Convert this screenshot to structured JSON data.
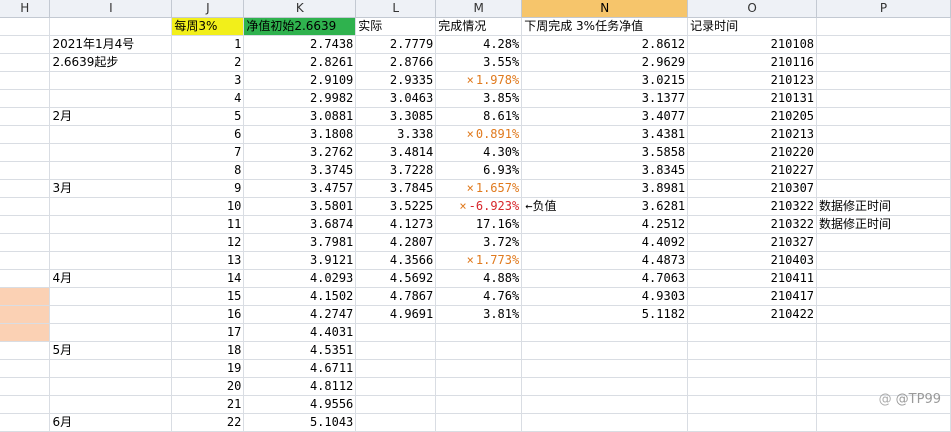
{
  "columns": [
    "H",
    "I",
    "J",
    "K",
    "L",
    "M",
    "N",
    "O",
    "P"
  ],
  "selected_column": "N",
  "header_row": {
    "J": "每周3%",
    "K": "净值初始2.6639",
    "L": "实际",
    "M": "完成情况",
    "N": "下周完成 3%任务净值",
    "O": "记录时间"
  },
  "rows": [
    {
      "I": "2021年1月4号",
      "J": "1",
      "K": "2.7438",
      "L": "2.7779",
      "M": "4.28%",
      "N": "2.8612",
      "O": "210108"
    },
    {
      "I": "2.6639起步",
      "J": "2",
      "K": "2.8261",
      "L": "2.8766",
      "M": "3.55%",
      "N": "2.9629",
      "O": "210116"
    },
    {
      "J": "3",
      "K": "2.9109",
      "L": "2.9335",
      "M": "1.978%",
      "mark": "×",
      "N": "3.0215",
      "O": "210123"
    },
    {
      "J": "4",
      "K": "2.9982",
      "L": "3.0463",
      "M": "3.85%",
      "N": "3.1377",
      "O": "210131"
    },
    {
      "I": "2月",
      "J": "5",
      "K": "3.0881",
      "L": "3.3085",
      "M": "8.61%",
      "N": "3.4077",
      "O": "210205"
    },
    {
      "J": "6",
      "K": "3.1808",
      "L": "3.338",
      "M": "0.891%",
      "mark": "×",
      "N": "3.4381",
      "O": "210213"
    },
    {
      "J": "7",
      "K": "3.2762",
      "L": "3.4814",
      "M": "4.30%",
      "N": "3.5858",
      "O": "210220"
    },
    {
      "J": "8",
      "K": "3.3745",
      "L": "3.7228",
      "M": "6.93%",
      "N": "3.8345",
      "O": "210227"
    },
    {
      "I": "3月",
      "J": "9",
      "K": "3.4757",
      "L": "3.7845",
      "M": "1.657%",
      "mark": "×",
      "N": "3.8981",
      "O": "210307"
    },
    {
      "J": "10",
      "K": "3.5801",
      "L": "3.5225",
      "M": "-6.923%",
      "mark": "×",
      "neg": true,
      "Nnote": "←负值",
      "N": "3.6281",
      "O": "210322",
      "P": "数据修正时间"
    },
    {
      "J": "11",
      "K": "3.6874",
      "L": "4.1273",
      "M": "17.16%",
      "N": "4.2512",
      "O": "210322",
      "P": "数据修正时间"
    },
    {
      "J": "12",
      "K": "3.7981",
      "L": "4.2807",
      "M": "3.72%",
      "N": "4.4092",
      "O": "210327"
    },
    {
      "J": "13",
      "K": "3.9121",
      "L": "4.3566",
      "M": "1.773%",
      "mark": "×",
      "N": "4.4873",
      "O": "210403"
    },
    {
      "I": "4月",
      "J": "14",
      "K": "4.0293",
      "L": "4.5692",
      "M": "4.88%",
      "N": "4.7063",
      "O": "210411"
    },
    {
      "J": "15",
      "K": "4.1502",
      "L": "4.7867",
      "M": "4.76%",
      "N": "4.9303",
      "O": "210417",
      "peach": true
    },
    {
      "J": "16",
      "K": "4.2747",
      "L": "4.9691",
      "M": "3.81%",
      "N": "5.1182",
      "O": "210422",
      "peach": true
    },
    {
      "J": "17",
      "K": "4.4031",
      "peach": true
    },
    {
      "I": "5月",
      "J": "18",
      "K": "4.5351"
    },
    {
      "J": "19",
      "K": "4.6711"
    },
    {
      "J": "20",
      "K": "4.8112"
    },
    {
      "J": "21",
      "K": "4.9556"
    },
    {
      "I": "6月",
      "J": "22",
      "K": "5.1043"
    }
  ],
  "watermark": {
    "logo": "@",
    "text": "@TP99"
  },
  "colors": {
    "column_header_bg": "#eef1f6",
    "selected_column_header": "#f6c56b",
    "yellow_fill": "#f2ef1a",
    "green_fill": "#2fb24e",
    "peach_fill": "#fbd1b4",
    "orange_text": "#e07a1e",
    "red_text": "#d7262b"
  }
}
